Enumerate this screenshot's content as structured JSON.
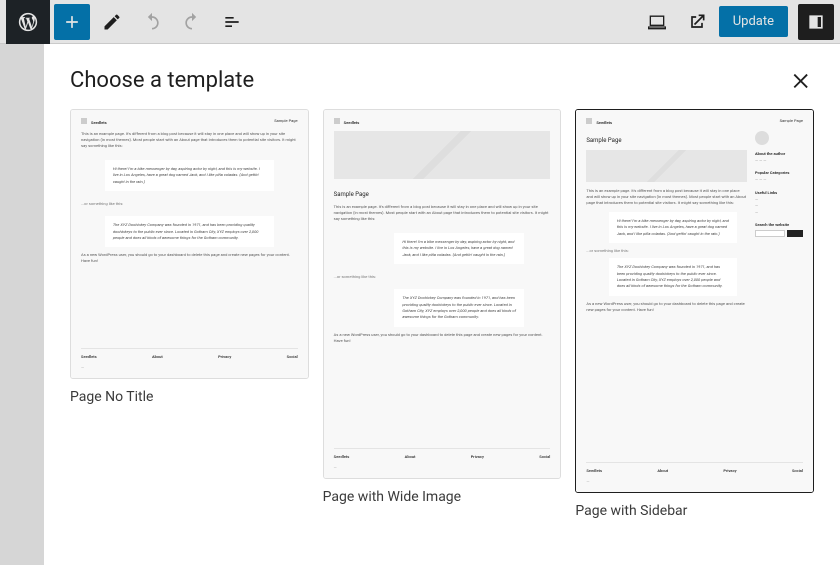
{
  "toolbar": {
    "update_label": "Update"
  },
  "modal": {
    "title": "Choose a template"
  },
  "templates": [
    {
      "label": "Page No Title",
      "selected": false
    },
    {
      "label": "Page with Wide Image",
      "selected": false
    },
    {
      "label": "Page with Sidebar",
      "selected": true
    }
  ],
  "thumb": {
    "brand": "Seedlets",
    "pageHeading": "Sample Page",
    "intro": "This is an example page. It's different from a blog post because it will stay in one place and will show up in your site navigation (in most themes). Most people start with an About page that introduces them to potential site visitors. It might say something like this:",
    "quote1": "Hi there! I'm a bike messenger by day, aspiring actor by night, and this is my website. I live in Los Angeles, have a great dog named Jack, and I like piña coladas. (And gettin' caught in the rain.)",
    "bridge": "...or something like this:",
    "quote2": "The XYZ Doohickey Company was founded in 1971, and has been providing quality doohickeys to the public ever since. Located in Gotham City, XYZ employs over 2,000 people and does all kinds of awesome things for the Gotham community.",
    "outro": "As a new WordPress user, you should go to your dashboard to delete this page and create new pages for your content. Have fun!",
    "footerCols": [
      "About",
      "Privacy",
      "Social"
    ],
    "sidebar": {
      "about": "About the author",
      "cats": "Popular Categories",
      "links": "Useful Links",
      "search": "Search the website"
    }
  }
}
